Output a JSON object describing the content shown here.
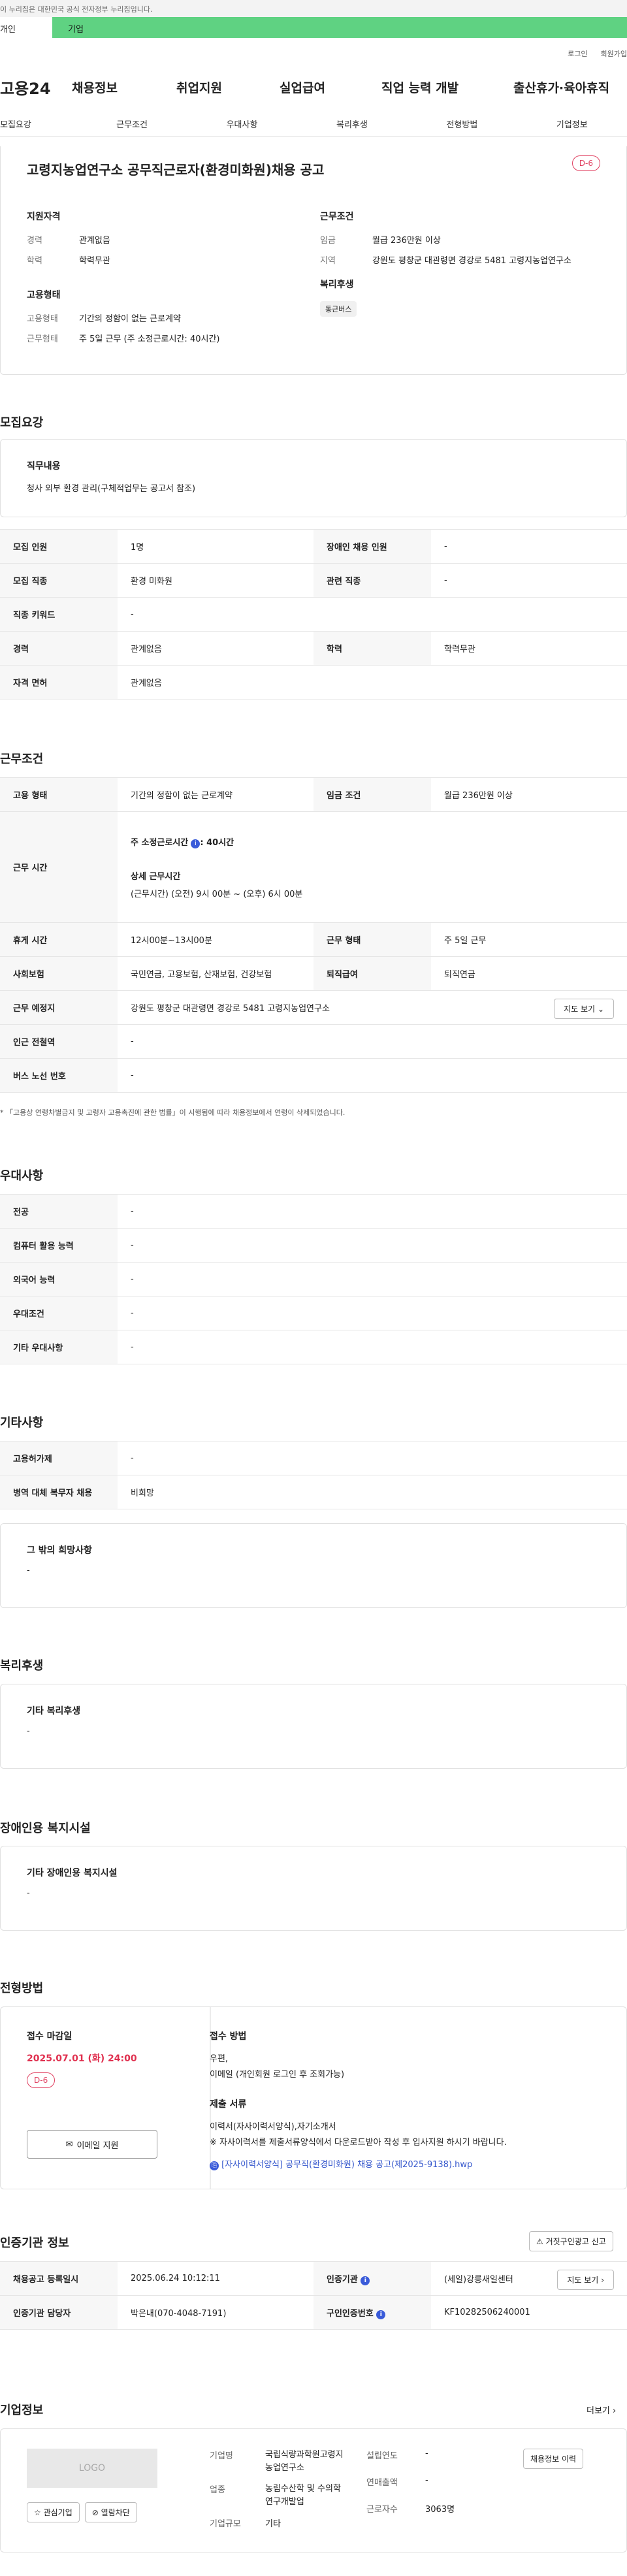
{
  "gov_bar": "이 누리집은 대한민국 공식 전자정부 누리집입니다.",
  "tabs": {
    "personal": "개인",
    "company": "기업"
  },
  "util": {
    "login": "로그인",
    "join": "회원가입"
  },
  "gnb": {
    "logo": "고용24",
    "items": [
      "채용정보",
      "취업지원",
      "실업급여",
      "직업 능력 개발",
      "출산휴가·육아휴직"
    ]
  },
  "subnav": [
    "모집요강",
    "근무조건",
    "우대사항",
    "복리후생",
    "전형방법",
    "기업정보"
  ],
  "summary": {
    "title": "고령지농업연구소 공무직근로자(환경미화원)채용 공고",
    "dday": "D-6",
    "qual_h": "지원자격",
    "career_k": "경력",
    "career_v": "관계없음",
    "edu_k": "학력",
    "edu_v": "학력무관",
    "work_h": "근무조건",
    "pay_k": "임금",
    "pay_v": "월급 236만원 이상",
    "area_k": "지역",
    "area_v": "강원도 평창군 대관령면 경강로 5481 고령지농업연구소",
    "emp_h": "고용형태",
    "emp_k": "고용형태",
    "emp_v": "기간의 정함이 없는 근로계약",
    "type_k": "근무형태",
    "type_v": "주 5일 근무 (주 소정근로시간: 40시간)",
    "welfare_h": "복리후생",
    "welfare_tag": "통근버스"
  },
  "recruit": {
    "title": "모집요강",
    "duty_h": "직무내용",
    "duty_v": "청사 외부 환경 관리(구체적업무는 공고서 참조)",
    "rows": [
      {
        "k1": "모집 인원",
        "v1": "1명",
        "k2": "장애인 채용 인원",
        "v2": "-"
      },
      {
        "k1": "모집 직종",
        "v1": "환경 미화원",
        "k2": "관련 직종",
        "v2": "-"
      },
      {
        "k1": "직종 키워드",
        "v1": "-"
      },
      {
        "k1": "경력",
        "v1": "관계없음",
        "k2": "학력",
        "v2": "학력무관"
      },
      {
        "k1": "자격 면허",
        "v1": "관계없음"
      }
    ]
  },
  "work": {
    "title": "근무조건",
    "emp_k": "고용 형태",
    "emp_v": "기간의 정함이 없는 근로계약",
    "pay_k": "임금 조건",
    "pay_v": "월급 236만원 이상",
    "hours_k": "근무 시간",
    "hours_a": "주 소정근로시간",
    "hours_b": ": 40시간",
    "hours_detail_h": "상세 근무시간",
    "hours_detail_v": "(근무시간) (오전) 9시 00분 ~ (오후) 6시 00분",
    "rest_k": "휴게 시간",
    "rest_v": "12시00분~13시00분",
    "wtype_k": "근무 형태",
    "wtype_v": "주 5일 근무",
    "ins_k": "사회보험",
    "ins_v": "국민연금, 고용보험, 산재보험, 건강보험",
    "ret_k": "퇴직급여",
    "ret_v": "퇴직연금",
    "place_k": "근무 예정지",
    "place_v": "강원도 평창군 대관령면 경강로 5481 고령지농업연구소",
    "map_btn": "지도 보기",
    "subway_k": "인근 전철역",
    "subway_v": "-",
    "bus_k": "버스 노선 번호",
    "bus_v": "-",
    "note": "* 「고용상 연령차별금지 및 고령자 고용촉진에 관한 법률」이 시행됨에 따라 채용정보에서 연령이 삭제되었습니다."
  },
  "prefer": {
    "title": "우대사항",
    "rows": [
      {
        "k": "전공",
        "v": "-"
      },
      {
        "k": "컴퓨터 활용 능력",
        "v": "-"
      },
      {
        "k": "외국어 능력",
        "v": "-"
      },
      {
        "k": "우대조건",
        "v": "-"
      },
      {
        "k": "기타 우대사항",
        "v": "-"
      }
    ]
  },
  "etc": {
    "title": "기타사항",
    "rows": [
      {
        "k": "고용허가제",
        "v": "-"
      },
      {
        "k": "병역 대체 복무자 채용",
        "v": "비희망"
      }
    ],
    "wish_h": "그 밖의 희망사항",
    "wish_v": "-"
  },
  "welfare": {
    "title": "복리후생",
    "h": "기타 복리후생",
    "v": "-"
  },
  "disabled": {
    "title": "장애인용 복지시설",
    "h": "기타 장애인용 복지시설",
    "v": "-"
  },
  "process": {
    "title": "전형방법",
    "deadline_h": "접수 마감일",
    "deadline_v": "2025.07.01 (화) 24:00",
    "dday": "D-6",
    "method_h": "접수 방법",
    "method_v1": "우편,",
    "method_v2": "이메일 (개인회원 로그인 후 조회가능)",
    "docs_h": "제출 서류",
    "docs_v1": "이력서(자사이력서양식),자기소개서",
    "docs_v2": "※ 자사이력서를 제출서류양식에서 다운로드받아 작성 후 입사지원 하시기 바랍니다.",
    "file": "[자사이력서양식] 공무직(환경미화원) 채용 공고(제2025-9138).hwp",
    "apply_btn": "이메일 지원"
  },
  "cert": {
    "title": "인증기관 정보",
    "report_btn": "거짓구인광고 신고",
    "reg_k": "채용공고 등록일시",
    "reg_v": "2025.06.24 10:12:11",
    "org_k": "인증기관",
    "org_v": "(세일)강릉새일센터",
    "map_btn": "지도 보기",
    "mgr_k": "인증기관 담당자",
    "mgr_v": "박은내(070-4048-7191)",
    "num_k": "구인인증번호",
    "num_v": "KF10282506240001"
  },
  "company": {
    "title": "기업정보",
    "more": "더보기",
    "logo": "LOGO",
    "fav_btn": "관심기업",
    "block_btn": "열람차단",
    "name_k": "기업명",
    "name_v": "국립식량과학원고령지농업연구소",
    "biz_k": "업종",
    "biz_v": "농림수산학 및 수의학 연구개발업",
    "size_k": "기업규모",
    "size_v": "기타",
    "year_k": "설립연도",
    "year_v": "-",
    "sales_k": "연매출액",
    "sales_v": "-",
    "emp_k": "근로자수",
    "emp_v": "3063명",
    "history_btn": "채용정보 이력"
  }
}
